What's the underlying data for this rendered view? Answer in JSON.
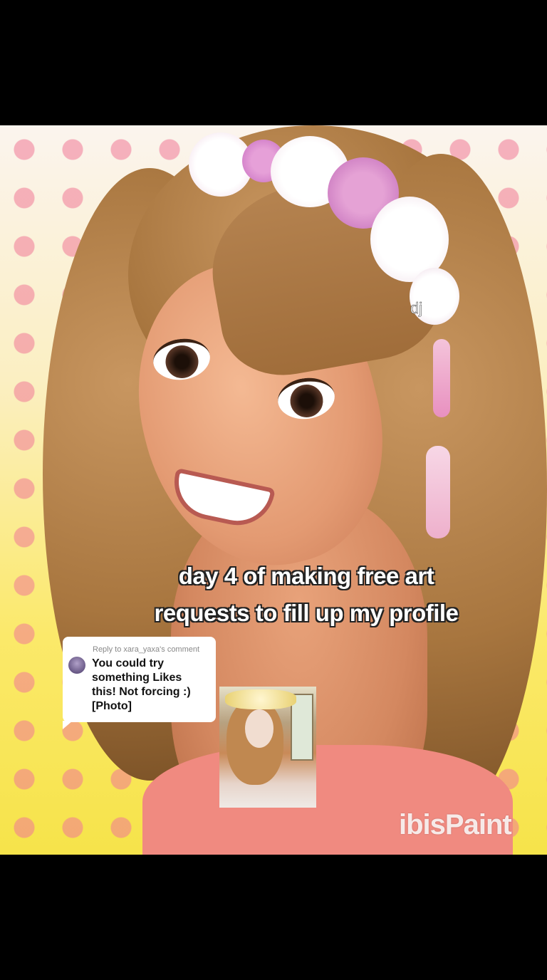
{
  "artwork": {
    "signature": "dj",
    "watermark": "ibisPaint"
  },
  "caption": {
    "line1": "day 4 of making free art",
    "line2": "requests to fill up my profile"
  },
  "reply_bubble": {
    "header": "Reply to xara_yaxa's comment",
    "text": "You could try\nsomething Likes\nthis! Not forcing :)\n[Photo]"
  },
  "colors": {
    "background_top": "#fbf4ee",
    "background_bottom": "#f6e34a",
    "polka_dot": "#f07896",
    "hair": "#a8763f",
    "dress": "#f08a80"
  }
}
